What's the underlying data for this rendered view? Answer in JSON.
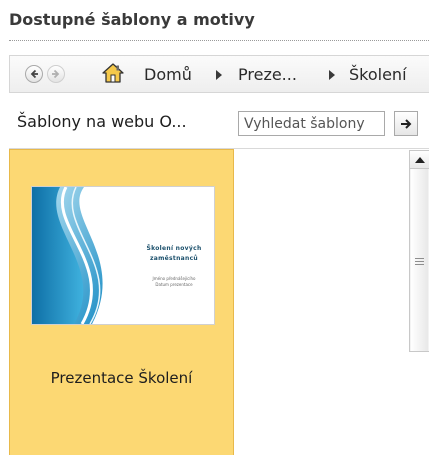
{
  "heading": "Dostupné šablony a motivy",
  "nav": {
    "back_icon": "arrow-left-icon",
    "forward_icon": "arrow-right-icon",
    "home_icon": "home-icon",
    "breadcrumbs": [
      "Domů",
      "Preze...",
      "Školení"
    ]
  },
  "online": {
    "label": "Šablony na webu O...",
    "search_placeholder": "Vyhledat šablony",
    "go_icon": "arrow-right-icon"
  },
  "templates": [
    {
      "caption": "Prezentace Školení",
      "thumb_title_1": "Školení nových",
      "thumb_title_2": "zaměstnanců",
      "thumb_sub_1": "Jméno přednášejícího",
      "thumb_sub_2": "Datum prezentace",
      "selected": true
    }
  ],
  "colors": {
    "selection": "#fcd873",
    "thumb_accent": "#1a8fc0"
  }
}
